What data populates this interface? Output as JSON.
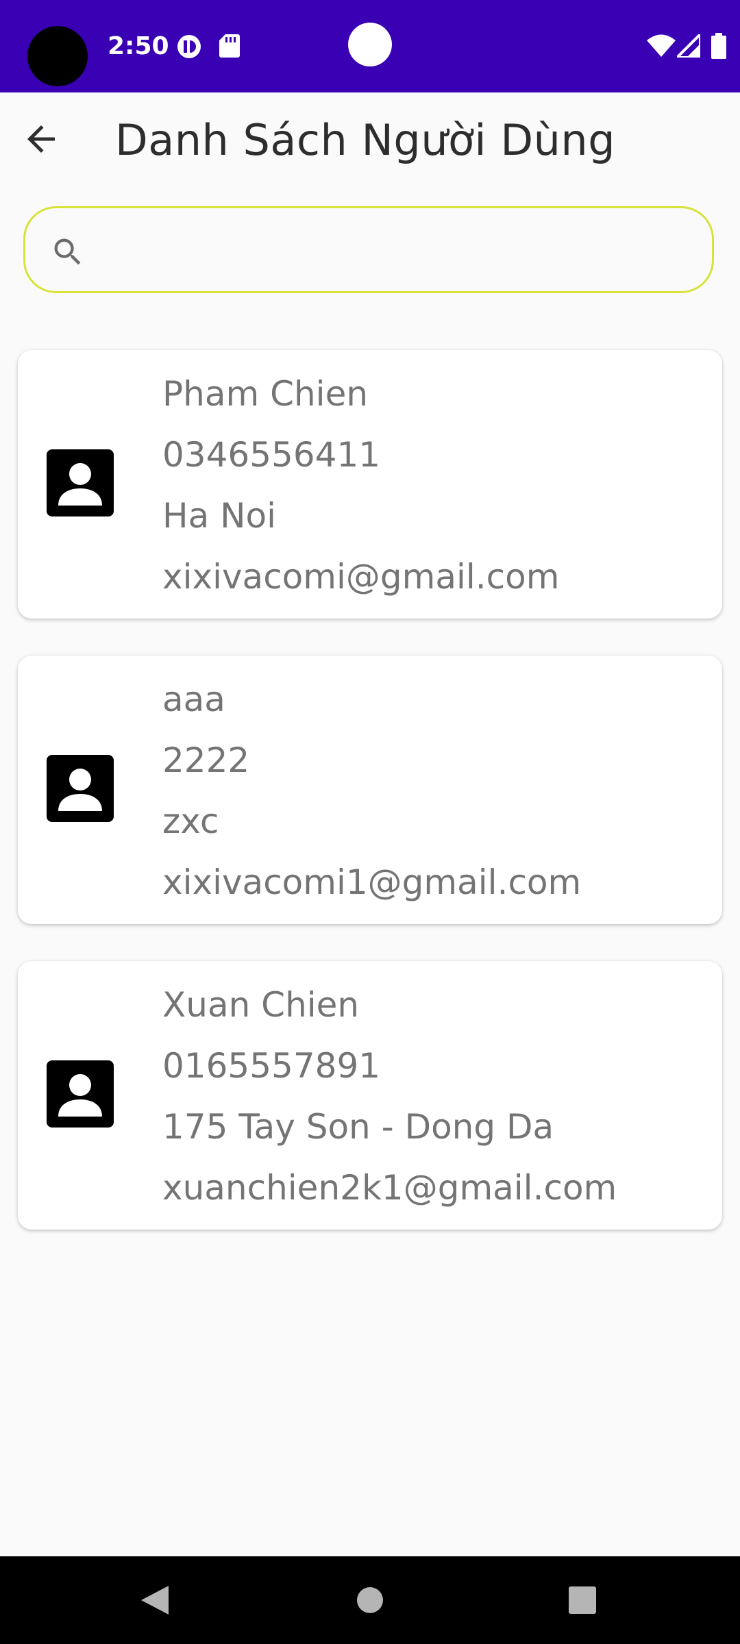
{
  "status_bar": {
    "time": "2:50",
    "icons": [
      "sync-icon",
      "sd-card-icon",
      "wifi-icon",
      "cellular-signal-icon",
      "battery-icon"
    ],
    "background": "#3a00b4"
  },
  "header": {
    "back_icon": "arrow-back-icon",
    "title": "Danh Sách Người Dùng"
  },
  "search": {
    "icon": "search-icon",
    "value": "",
    "placeholder": "",
    "border_color": "#d8e33a"
  },
  "users": [
    {
      "name": "Pham Chien",
      "phone": "0346556411",
      "address": "Ha Noi",
      "email": "xixivacomi@gmail.com",
      "icon": "contact-icon"
    },
    {
      "name": "aaa",
      "phone": "2222",
      "address": "zxc",
      "email": "xixivacomi1@gmail.com",
      "icon": "contact-icon"
    },
    {
      "name": "Xuan Chien",
      "phone": "0165557891",
      "address": "175 Tay Son - Dong Da",
      "email": "xuanchien2k1@gmail.com",
      "icon": "contact-icon"
    }
  ],
  "nav_bar": {
    "buttons": [
      "back-triangle-icon",
      "home-circle-icon",
      "recents-square-icon"
    ]
  }
}
